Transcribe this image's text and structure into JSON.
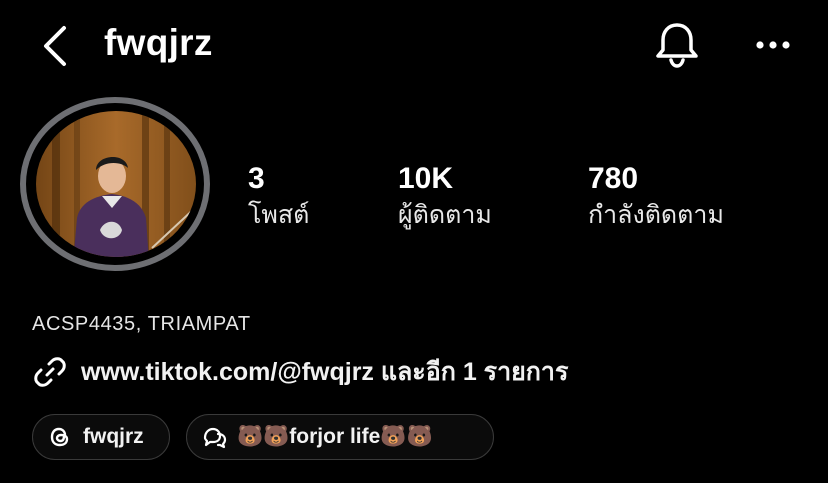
{
  "header": {
    "username": "fwqjrz",
    "back_icon": "chevron-left-icon",
    "bell_icon": "bell-icon",
    "more_icon": "more-horizontal-icon"
  },
  "profile": {
    "avatar": "profile-photo"
  },
  "stats": [
    {
      "value": "3",
      "label": "โพสต์"
    },
    {
      "value": "10K",
      "label": "ผู้ติดตาม"
    },
    {
      "value": "780",
      "label": "กำลังติดตาม"
    }
  ],
  "bio": {
    "category": "ACSP4435, TRIAMPAT",
    "link_text": "www.tiktok.com/@fwqjrz และอีก 1 รายการ",
    "link_icon": "link-icon"
  },
  "chips": {
    "threads_label": "fwqjrz",
    "threads_icon": "threads-icon",
    "note_label": "🐻🐻forjor life🐻🐻",
    "note_icon": "note-bubble-icon"
  },
  "colors": {
    "background": "#000000",
    "text": "#ffffff",
    "avatar_ring": "#6e6f73",
    "chip_border": "#3a3a3a"
  }
}
